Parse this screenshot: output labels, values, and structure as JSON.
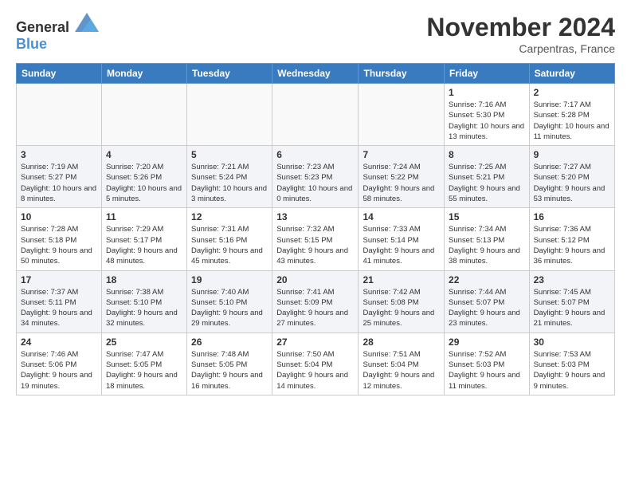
{
  "logo": {
    "text_general": "General",
    "text_blue": "Blue"
  },
  "title": "November 2024",
  "subtitle": "Carpentras, France",
  "days_header": [
    "Sunday",
    "Monday",
    "Tuesday",
    "Wednesday",
    "Thursday",
    "Friday",
    "Saturday"
  ],
  "weeks": [
    [
      {
        "day": "",
        "info": ""
      },
      {
        "day": "",
        "info": ""
      },
      {
        "day": "",
        "info": ""
      },
      {
        "day": "",
        "info": ""
      },
      {
        "day": "",
        "info": ""
      },
      {
        "day": "1",
        "info": "Sunrise: 7:16 AM\nSunset: 5:30 PM\nDaylight: 10 hours and 13 minutes."
      },
      {
        "day": "2",
        "info": "Sunrise: 7:17 AM\nSunset: 5:28 PM\nDaylight: 10 hours and 11 minutes."
      }
    ],
    [
      {
        "day": "3",
        "info": "Sunrise: 7:19 AM\nSunset: 5:27 PM\nDaylight: 10 hours and 8 minutes."
      },
      {
        "day": "4",
        "info": "Sunrise: 7:20 AM\nSunset: 5:26 PM\nDaylight: 10 hours and 5 minutes."
      },
      {
        "day": "5",
        "info": "Sunrise: 7:21 AM\nSunset: 5:24 PM\nDaylight: 10 hours and 3 minutes."
      },
      {
        "day": "6",
        "info": "Sunrise: 7:23 AM\nSunset: 5:23 PM\nDaylight: 10 hours and 0 minutes."
      },
      {
        "day": "7",
        "info": "Sunrise: 7:24 AM\nSunset: 5:22 PM\nDaylight: 9 hours and 58 minutes."
      },
      {
        "day": "8",
        "info": "Sunrise: 7:25 AM\nSunset: 5:21 PM\nDaylight: 9 hours and 55 minutes."
      },
      {
        "day": "9",
        "info": "Sunrise: 7:27 AM\nSunset: 5:20 PM\nDaylight: 9 hours and 53 minutes."
      }
    ],
    [
      {
        "day": "10",
        "info": "Sunrise: 7:28 AM\nSunset: 5:18 PM\nDaylight: 9 hours and 50 minutes."
      },
      {
        "day": "11",
        "info": "Sunrise: 7:29 AM\nSunset: 5:17 PM\nDaylight: 9 hours and 48 minutes."
      },
      {
        "day": "12",
        "info": "Sunrise: 7:31 AM\nSunset: 5:16 PM\nDaylight: 9 hours and 45 minutes."
      },
      {
        "day": "13",
        "info": "Sunrise: 7:32 AM\nSunset: 5:15 PM\nDaylight: 9 hours and 43 minutes."
      },
      {
        "day": "14",
        "info": "Sunrise: 7:33 AM\nSunset: 5:14 PM\nDaylight: 9 hours and 41 minutes."
      },
      {
        "day": "15",
        "info": "Sunrise: 7:34 AM\nSunset: 5:13 PM\nDaylight: 9 hours and 38 minutes."
      },
      {
        "day": "16",
        "info": "Sunrise: 7:36 AM\nSunset: 5:12 PM\nDaylight: 9 hours and 36 minutes."
      }
    ],
    [
      {
        "day": "17",
        "info": "Sunrise: 7:37 AM\nSunset: 5:11 PM\nDaylight: 9 hours and 34 minutes."
      },
      {
        "day": "18",
        "info": "Sunrise: 7:38 AM\nSunset: 5:10 PM\nDaylight: 9 hours and 32 minutes."
      },
      {
        "day": "19",
        "info": "Sunrise: 7:40 AM\nSunset: 5:10 PM\nDaylight: 9 hours and 29 minutes."
      },
      {
        "day": "20",
        "info": "Sunrise: 7:41 AM\nSunset: 5:09 PM\nDaylight: 9 hours and 27 minutes."
      },
      {
        "day": "21",
        "info": "Sunrise: 7:42 AM\nSunset: 5:08 PM\nDaylight: 9 hours and 25 minutes."
      },
      {
        "day": "22",
        "info": "Sunrise: 7:44 AM\nSunset: 5:07 PM\nDaylight: 9 hours and 23 minutes."
      },
      {
        "day": "23",
        "info": "Sunrise: 7:45 AM\nSunset: 5:07 PM\nDaylight: 9 hours and 21 minutes."
      }
    ],
    [
      {
        "day": "24",
        "info": "Sunrise: 7:46 AM\nSunset: 5:06 PM\nDaylight: 9 hours and 19 minutes."
      },
      {
        "day": "25",
        "info": "Sunrise: 7:47 AM\nSunset: 5:05 PM\nDaylight: 9 hours and 18 minutes."
      },
      {
        "day": "26",
        "info": "Sunrise: 7:48 AM\nSunset: 5:05 PM\nDaylight: 9 hours and 16 minutes."
      },
      {
        "day": "27",
        "info": "Sunrise: 7:50 AM\nSunset: 5:04 PM\nDaylight: 9 hours and 14 minutes."
      },
      {
        "day": "28",
        "info": "Sunrise: 7:51 AM\nSunset: 5:04 PM\nDaylight: 9 hours and 12 minutes."
      },
      {
        "day": "29",
        "info": "Sunrise: 7:52 AM\nSunset: 5:03 PM\nDaylight: 9 hours and 11 minutes."
      },
      {
        "day": "30",
        "info": "Sunrise: 7:53 AM\nSunset: 5:03 PM\nDaylight: 9 hours and 9 minutes."
      }
    ]
  ]
}
